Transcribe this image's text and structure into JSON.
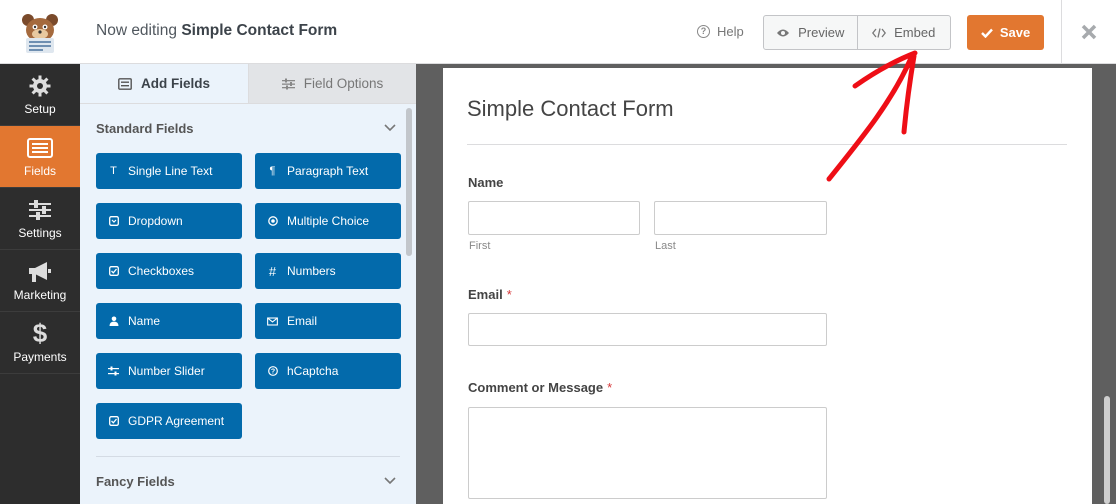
{
  "header": {
    "title_prefix": "Now editing",
    "form_name": "Simple Contact Form",
    "help_label": "Help",
    "preview_label": "Preview",
    "embed_label": "Embed",
    "save_label": "Save",
    "save_color": "#e27730"
  },
  "left_nav": {
    "items": [
      {
        "label": "Setup",
        "icon": "gear-icon"
      },
      {
        "label": "Fields",
        "icon": "fields-icon",
        "active": true
      },
      {
        "label": "Settings",
        "icon": "sliders-icon"
      },
      {
        "label": "Marketing",
        "icon": "megaphone-icon"
      },
      {
        "label": "Payments",
        "icon": "dollar-icon"
      }
    ]
  },
  "panel": {
    "tabs": [
      {
        "label": "Add Fields",
        "icon": "list-icon",
        "active": true
      },
      {
        "label": "Field Options",
        "icon": "sliders-icon"
      }
    ],
    "standard_fields_title": "Standard Fields",
    "standard_fields": [
      {
        "label": "Single Line Text",
        "icon": "text-icon"
      },
      {
        "label": "Paragraph Text",
        "icon": "paragraph-icon"
      },
      {
        "label": "Dropdown",
        "icon": "dropdown-icon"
      },
      {
        "label": "Multiple Choice",
        "icon": "radio-icon"
      },
      {
        "label": "Checkboxes",
        "icon": "checkbox-icon"
      },
      {
        "label": "Numbers",
        "icon": "hash-icon"
      },
      {
        "label": "Name",
        "icon": "user-icon"
      },
      {
        "label": "Email",
        "icon": "envelope-icon"
      },
      {
        "label": "Number Slider",
        "icon": "sliders-icon"
      },
      {
        "label": "hCaptcha",
        "icon": "question-icon"
      },
      {
        "label": "GDPR Agreement",
        "icon": "checkbox-icon"
      }
    ],
    "fancy_fields_title": "Fancy Fields",
    "field_button_color": "#036aab"
  },
  "form": {
    "title": "Simple Contact Form",
    "name_label": "Name",
    "first_sublabel": "First",
    "last_sublabel": "Last",
    "email_label": "Email",
    "comment_label": "Comment or Message",
    "required_marker": "*"
  },
  "annotation": {
    "color": "#ee0e16"
  }
}
